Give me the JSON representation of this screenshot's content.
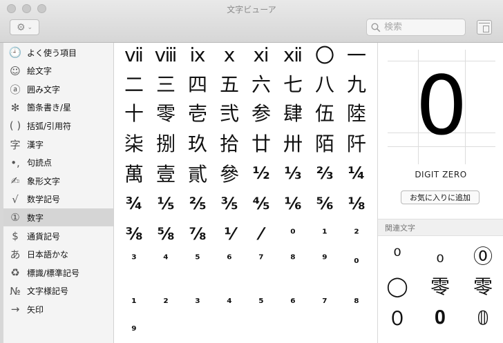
{
  "window": {
    "title": "文字ビューア"
  },
  "toolbar": {
    "gear_icon": "gear-icon",
    "search_placeholder": "検索",
    "panel_icon": "sidebar-panel-icon"
  },
  "sidebar": {
    "items": [
      {
        "icon": "🕘",
        "icon_name": "clock-icon",
        "label": "よく使う項目"
      },
      {
        "icon": "☺",
        "icon_name": "smiley-icon",
        "label": "絵文字"
      },
      {
        "icon": "ⓐ",
        "icon_name": "circled-a-icon",
        "label": "囲み文字"
      },
      {
        "icon": "✻",
        "icon_name": "asterisk-icon",
        "label": "箇条書き/星"
      },
      {
        "icon": "( )",
        "icon_name": "parentheses-icon",
        "label": "括弧/引用符"
      },
      {
        "icon": "字",
        "icon_name": "kanji-icon",
        "label": "漢字"
      },
      {
        "icon": "•,",
        "icon_name": "punctuation-icon",
        "label": "句読点"
      },
      {
        "icon": "✍",
        "icon_name": "pictograph-icon",
        "label": "象形文字"
      },
      {
        "icon": "√",
        "icon_name": "math-icon",
        "label": "数学記号"
      },
      {
        "icon": "①",
        "icon_name": "circled-one-icon",
        "label": "数字"
      },
      {
        "icon": "$",
        "icon_name": "dollar-icon",
        "label": "通貨記号"
      },
      {
        "icon": "あ",
        "icon_name": "hiragana-icon",
        "label": "日本語かな"
      },
      {
        "icon": "♻",
        "icon_name": "recycle-icon",
        "label": "標識/標準記号"
      },
      {
        "icon": "№",
        "icon_name": "numero-icon",
        "label": "文字様記号"
      },
      {
        "icon": "→",
        "icon_name": "arrow-icon",
        "label": "矢印"
      }
    ],
    "selected_index": 9
  },
  "grid": {
    "rows": [
      [
        "ⅶ",
        "ⅷ",
        "ⅸ",
        "ⅹ",
        "ⅺ",
        "ⅻ",
        "〇",
        "一"
      ],
      [
        "二",
        "三",
        "四",
        "五",
        "六",
        "七",
        "八",
        "九"
      ],
      [
        "十",
        "零",
        "壱",
        "弐",
        "参",
        "肆",
        "伍",
        "陸"
      ],
      [
        "柒",
        "捌",
        "玖",
        "拾",
        "廿",
        "卅",
        "陌",
        "阡"
      ],
      [
        "萬",
        "壹",
        "貳",
        "參",
        "½",
        "⅓",
        "⅔",
        "¼"
      ],
      [
        "¾",
        "⅕",
        "⅖",
        "⅗",
        "⅘",
        "⅙",
        "⅚",
        "⅛"
      ],
      [
        "⅜",
        "⅝",
        "⅞",
        "⅟",
        "⁄",
        "⁰",
        "¹",
        "²"
      ],
      [
        "³",
        "⁴",
        "⁵",
        "⁶",
        "⁷",
        "⁸",
        "⁹",
        "₀"
      ],
      [
        "₁",
        "₂",
        "₃",
        "₄",
        "₅",
        "₆",
        "₇",
        "₈"
      ],
      [
        "₉"
      ]
    ]
  },
  "detail": {
    "preview_char": "0",
    "char_name": "DIGIT ZERO",
    "favorite_button": "お気に入りに追加",
    "related_header": "関連文字",
    "related": [
      [
        "⁰",
        "₀",
        "⓪"
      ],
      [
        "◯",
        "零",
        "零"
      ],
      [
        "０",
        "𝟎",
        "𝟘"
      ]
    ]
  }
}
